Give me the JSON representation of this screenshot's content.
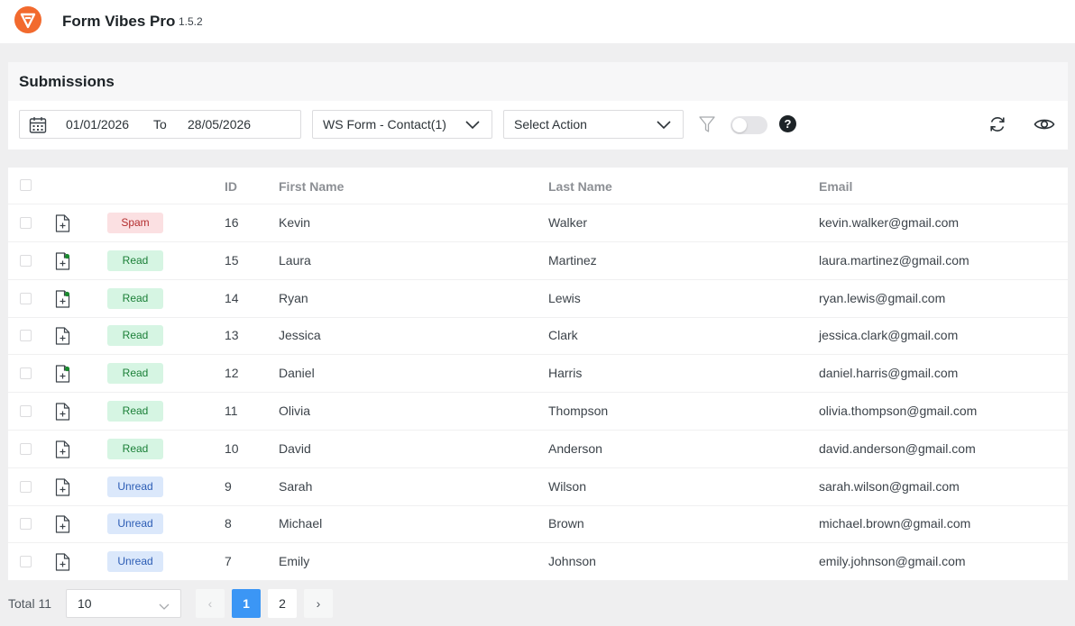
{
  "app": {
    "title": "Form Vibes Pro",
    "version": "1.5.2"
  },
  "page": {
    "title": "Submissions"
  },
  "filters": {
    "date_from": "01/01/2026",
    "date_to_label": "To",
    "date_to": "28/05/2026",
    "form_select": "WS Form - Contact(1)",
    "action_select": "Select Action"
  },
  "table": {
    "headers": {
      "id": "ID",
      "first_name": "First Name",
      "last_name": "Last Name",
      "email": "Email"
    },
    "rows": [
      {
        "status": "Spam",
        "status_type": "spam",
        "has_note": false,
        "id": "16",
        "first_name": "Kevin",
        "last_name": "Walker",
        "email": "kevin.walker@gmail.com"
      },
      {
        "status": "Read",
        "status_type": "read",
        "has_note": true,
        "id": "15",
        "first_name": "Laura",
        "last_name": "Martinez",
        "email": "laura.martinez@gmail.com"
      },
      {
        "status": "Read",
        "status_type": "read",
        "has_note": true,
        "id": "14",
        "first_name": "Ryan",
        "last_name": "Lewis",
        "email": "ryan.lewis@gmail.com"
      },
      {
        "status": "Read",
        "status_type": "read",
        "has_note": false,
        "id": "13",
        "first_name": "Jessica",
        "last_name": "Clark",
        "email": "jessica.clark@gmail.com"
      },
      {
        "status": "Read",
        "status_type": "read",
        "has_note": true,
        "id": "12",
        "first_name": "Daniel",
        "last_name": "Harris",
        "email": "daniel.harris@gmail.com"
      },
      {
        "status": "Read",
        "status_type": "read",
        "has_note": false,
        "id": "11",
        "first_name": "Olivia",
        "last_name": "Thompson",
        "email": "olivia.thompson@gmail.com"
      },
      {
        "status": "Read",
        "status_type": "read",
        "has_note": false,
        "id": "10",
        "first_name": "David",
        "last_name": "Anderson",
        "email": "david.anderson@gmail.com"
      },
      {
        "status": "Unread",
        "status_type": "unread",
        "has_note": false,
        "id": "9",
        "first_name": "Sarah",
        "last_name": "Wilson",
        "email": "sarah.wilson@gmail.com"
      },
      {
        "status": "Unread",
        "status_type": "unread",
        "has_note": false,
        "id": "8",
        "first_name": "Michael",
        "last_name": "Brown",
        "email": "michael.brown@gmail.com"
      },
      {
        "status": "Unread",
        "status_type": "unread",
        "has_note": false,
        "id": "7",
        "first_name": "Emily",
        "last_name": "Johnson",
        "email": "emily.johnson@gmail.com"
      }
    ]
  },
  "footer": {
    "total_label": "Total 11",
    "page_size": "10",
    "pages": [
      "1",
      "2"
    ],
    "current_page": "1",
    "prev_glyph": "‹",
    "next_glyph": "›"
  },
  "icons": {
    "logo": "form-vibes-logo-icon",
    "calendar": "calendar-icon",
    "filter": "filter-icon",
    "help": "help-icon",
    "refresh": "refresh-icon",
    "visibility": "eye-icon",
    "entry": "document-plus-icon"
  },
  "colors": {
    "brand": "#f26a2e",
    "accent": "#3b96f5",
    "spam": "#b32d2e",
    "read": "#1a7f37",
    "unread": "#2c5db5",
    "note_dot": "#1a8a2e"
  }
}
